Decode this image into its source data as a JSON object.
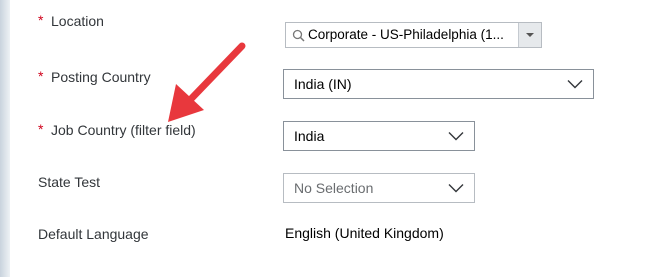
{
  "form": {
    "location": {
      "label": "Location",
      "required_marker": "*",
      "value": "Corporate - US-Philadelphia (1..."
    },
    "posting_country": {
      "label": "Posting Country",
      "required_marker": "*",
      "value": "India (IN)"
    },
    "job_country": {
      "label": "Job Country (filter field)",
      "required_marker": "*",
      "value": "India"
    },
    "state_test": {
      "label": "State Test",
      "value": "No Selection"
    },
    "default_language": {
      "label": "Default Language",
      "value": "English (United Kingdom)"
    }
  },
  "colors": {
    "required": "#d0021b",
    "annotation_arrow": "#e8383d",
    "field_border": "#89919a"
  },
  "icons": {
    "search": "search-icon",
    "dropdown": "chevron-down-icon",
    "arrow": "annotation-arrow-icon"
  }
}
